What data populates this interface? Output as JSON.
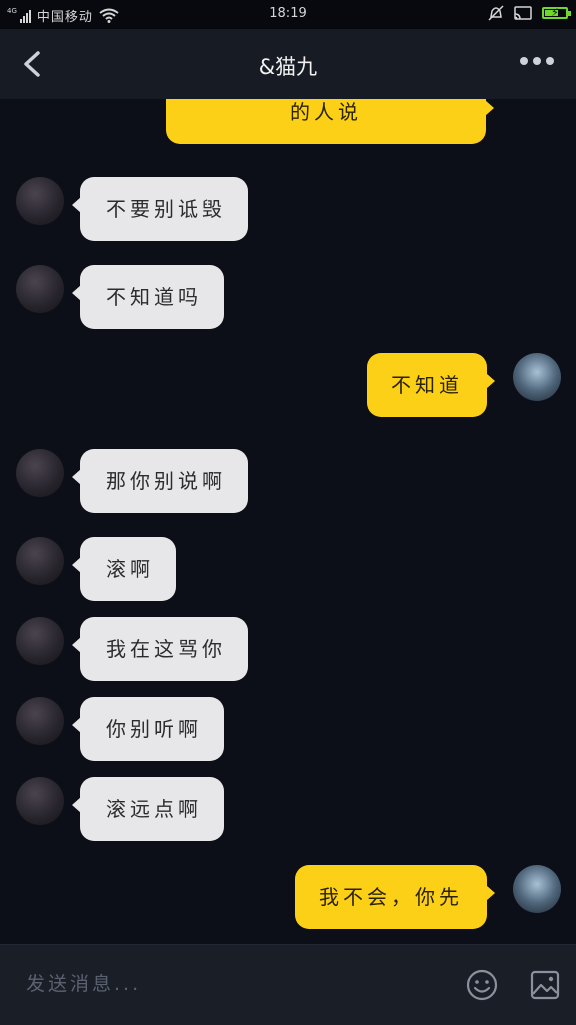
{
  "status_bar": {
    "network": "4G",
    "carrier": "中国移动",
    "time": "18:19"
  },
  "header": {
    "title": "&猫九",
    "back_icon": "back-arrow",
    "more_icon": "more-dots"
  },
  "messages": [
    {
      "side": "me",
      "text": "的人说",
      "partial": true
    },
    {
      "side": "them",
      "text": "不要别诋毁"
    },
    {
      "side": "them",
      "text": "不知道吗"
    },
    {
      "side": "me",
      "text": "不知道"
    },
    {
      "side": "them",
      "text": "那你别说啊"
    },
    {
      "side": "them",
      "text": "滚啊"
    },
    {
      "side": "them",
      "text": "我在这骂你"
    },
    {
      "side": "them",
      "text": "你别听啊"
    },
    {
      "side": "them",
      "text": "滚远点啊"
    },
    {
      "side": "me",
      "text": "我不会，你先"
    }
  ],
  "input": {
    "placeholder": "发送消息..."
  },
  "colors": {
    "background": "#0c0f17",
    "header": "#171b23",
    "my_bubble": "#fdd018",
    "their_bubble": "#e7e7e9"
  }
}
